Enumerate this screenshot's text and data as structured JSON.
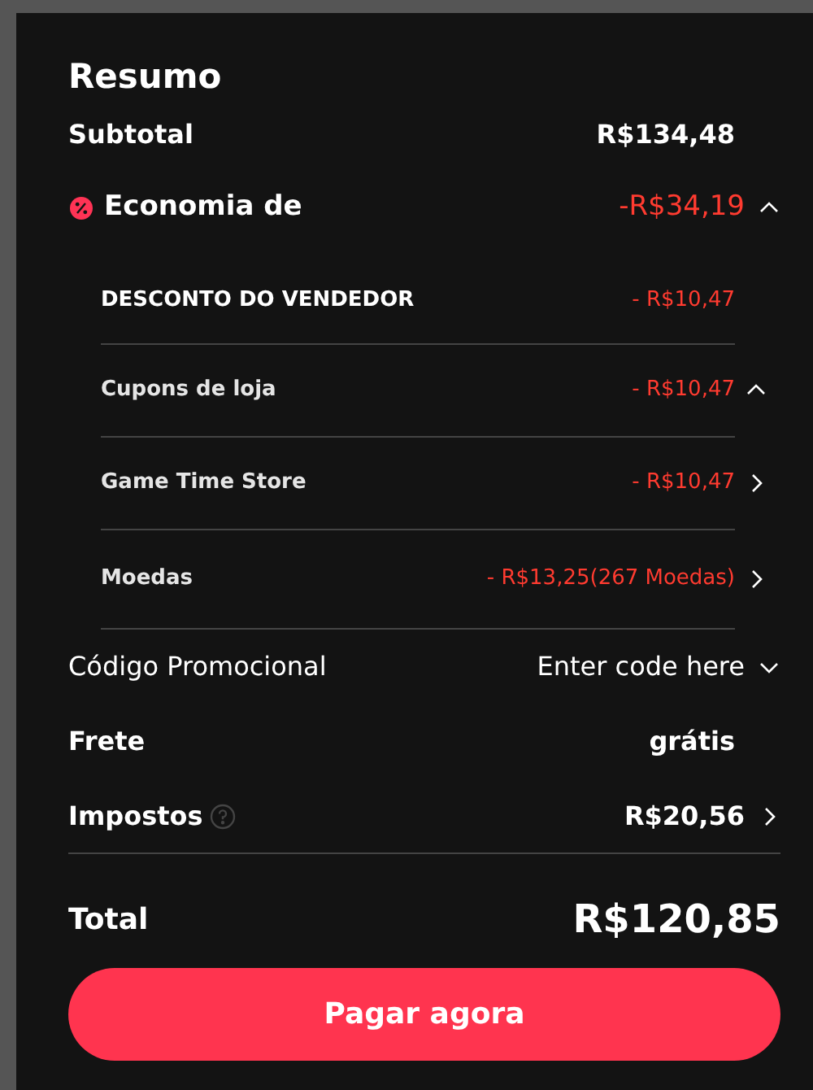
{
  "title": "Resumo",
  "subtotal": {
    "label": "Subtotal",
    "value": "R$134,48"
  },
  "savings": {
    "label": "Economia de",
    "value": "-R$34,19",
    "expanded": true,
    "items": [
      {
        "label": "DESCONTO DO VENDEDOR",
        "value": "- R$10,47",
        "kind": "plain"
      },
      {
        "label": "Cupons de loja",
        "value": "- R$10,47",
        "kind": "expandable",
        "expanded": true
      },
      {
        "label": "Game Time Store",
        "value": "- R$10,47",
        "kind": "link"
      },
      {
        "label": "Moedas",
        "value": "- R$13,25(267 Moedas)",
        "kind": "link"
      }
    ]
  },
  "promo_code": {
    "label": "Código Promocional",
    "placeholder": "Enter code here",
    "expanded": false
  },
  "shipping": {
    "label": "Frete",
    "value": "grátis"
  },
  "taxes": {
    "label": "Impostos",
    "value": "R$20,56"
  },
  "total": {
    "label": "Total",
    "value": "R$120,85"
  },
  "pay_button": "Pagar agora"
}
